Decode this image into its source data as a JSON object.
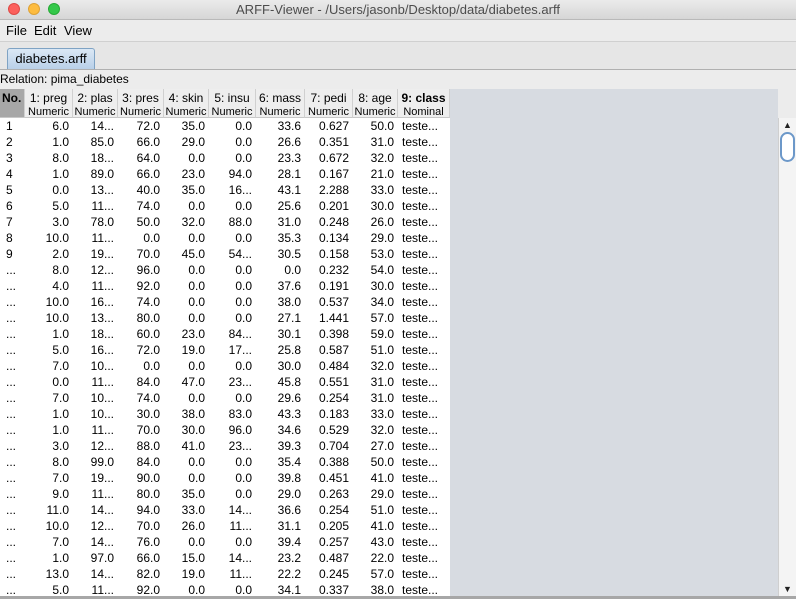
{
  "window": {
    "title": "ARFF-Viewer - /Users/jasonb/Desktop/data/diabetes.arff"
  },
  "menu": {
    "file": "File",
    "edit": "Edit",
    "view": "View"
  },
  "tab": {
    "label": "diabetes.arff"
  },
  "relation": "Relation: pima_diabetes",
  "columns": [
    {
      "name": "No.",
      "type": ""
    },
    {
      "name": "1: preg",
      "type": "Numeric"
    },
    {
      "name": "2: plas",
      "type": "Numeric"
    },
    {
      "name": "3: pres",
      "type": "Numeric"
    },
    {
      "name": "4: skin",
      "type": "Numeric"
    },
    {
      "name": "5: insu",
      "type": "Numeric"
    },
    {
      "name": "6: mass",
      "type": "Numeric"
    },
    {
      "name": "7: pedi",
      "type": "Numeric"
    },
    {
      "name": "8: age",
      "type": "Numeric"
    },
    {
      "name": "9: class",
      "type": "Nominal"
    }
  ],
  "rows": [
    [
      "1",
      "6.0",
      "14...",
      "72.0",
      "35.0",
      "0.0",
      "33.6",
      "0.627",
      "50.0",
      "teste..."
    ],
    [
      "2",
      "1.0",
      "85.0",
      "66.0",
      "29.0",
      "0.0",
      "26.6",
      "0.351",
      "31.0",
      "teste..."
    ],
    [
      "3",
      "8.0",
      "18...",
      "64.0",
      "0.0",
      "0.0",
      "23.3",
      "0.672",
      "32.0",
      "teste..."
    ],
    [
      "4",
      "1.0",
      "89.0",
      "66.0",
      "23.0",
      "94.0",
      "28.1",
      "0.167",
      "21.0",
      "teste..."
    ],
    [
      "5",
      "0.0",
      "13...",
      "40.0",
      "35.0",
      "16...",
      "43.1",
      "2.288",
      "33.0",
      "teste..."
    ],
    [
      "6",
      "5.0",
      "11...",
      "74.0",
      "0.0",
      "0.0",
      "25.6",
      "0.201",
      "30.0",
      "teste..."
    ],
    [
      "7",
      "3.0",
      "78.0",
      "50.0",
      "32.0",
      "88.0",
      "31.0",
      "0.248",
      "26.0",
      "teste..."
    ],
    [
      "8",
      "10.0",
      "11...",
      "0.0",
      "0.0",
      "0.0",
      "35.3",
      "0.134",
      "29.0",
      "teste..."
    ],
    [
      "9",
      "2.0",
      "19...",
      "70.0",
      "45.0",
      "54...",
      "30.5",
      "0.158",
      "53.0",
      "teste..."
    ],
    [
      "...",
      "8.0",
      "12...",
      "96.0",
      "0.0",
      "0.0",
      "0.0",
      "0.232",
      "54.0",
      "teste..."
    ],
    [
      "...",
      "4.0",
      "11...",
      "92.0",
      "0.0",
      "0.0",
      "37.6",
      "0.191",
      "30.0",
      "teste..."
    ],
    [
      "...",
      "10.0",
      "16...",
      "74.0",
      "0.0",
      "0.0",
      "38.0",
      "0.537",
      "34.0",
      "teste..."
    ],
    [
      "...",
      "10.0",
      "13...",
      "80.0",
      "0.0",
      "0.0",
      "27.1",
      "1.441",
      "57.0",
      "teste..."
    ],
    [
      "...",
      "1.0",
      "18...",
      "60.0",
      "23.0",
      "84...",
      "30.1",
      "0.398",
      "59.0",
      "teste..."
    ],
    [
      "...",
      "5.0",
      "16...",
      "72.0",
      "19.0",
      "17...",
      "25.8",
      "0.587",
      "51.0",
      "teste..."
    ],
    [
      "...",
      "7.0",
      "10...",
      "0.0",
      "0.0",
      "0.0",
      "30.0",
      "0.484",
      "32.0",
      "teste..."
    ],
    [
      "...",
      "0.0",
      "11...",
      "84.0",
      "47.0",
      "23...",
      "45.8",
      "0.551",
      "31.0",
      "teste..."
    ],
    [
      "...",
      "7.0",
      "10...",
      "74.0",
      "0.0",
      "0.0",
      "29.6",
      "0.254",
      "31.0",
      "teste..."
    ],
    [
      "...",
      "1.0",
      "10...",
      "30.0",
      "38.0",
      "83.0",
      "43.3",
      "0.183",
      "33.0",
      "teste..."
    ],
    [
      "...",
      "1.0",
      "11...",
      "70.0",
      "30.0",
      "96.0",
      "34.6",
      "0.529",
      "32.0",
      "teste..."
    ],
    [
      "...",
      "3.0",
      "12...",
      "88.0",
      "41.0",
      "23...",
      "39.3",
      "0.704",
      "27.0",
      "teste..."
    ],
    [
      "...",
      "8.0",
      "99.0",
      "84.0",
      "0.0",
      "0.0",
      "35.4",
      "0.388",
      "50.0",
      "teste..."
    ],
    [
      "...",
      "7.0",
      "19...",
      "90.0",
      "0.0",
      "0.0",
      "39.8",
      "0.451",
      "41.0",
      "teste..."
    ],
    [
      "...",
      "9.0",
      "11...",
      "80.0",
      "35.0",
      "0.0",
      "29.0",
      "0.263",
      "29.0",
      "teste..."
    ],
    [
      "...",
      "11.0",
      "14...",
      "94.0",
      "33.0",
      "14...",
      "36.6",
      "0.254",
      "51.0",
      "teste..."
    ],
    [
      "...",
      "10.0",
      "12...",
      "70.0",
      "26.0",
      "11...",
      "31.1",
      "0.205",
      "41.0",
      "teste..."
    ],
    [
      "...",
      "7.0",
      "14...",
      "76.0",
      "0.0",
      "0.0",
      "39.4",
      "0.257",
      "43.0",
      "teste..."
    ],
    [
      "...",
      "1.0",
      "97.0",
      "66.0",
      "15.0",
      "14...",
      "23.2",
      "0.487",
      "22.0",
      "teste..."
    ],
    [
      "...",
      "13.0",
      "14...",
      "82.0",
      "19.0",
      "11...",
      "22.2",
      "0.245",
      "57.0",
      "teste..."
    ],
    [
      "...",
      "5.0",
      "11...",
      "92.0",
      "0.0",
      "0.0",
      "34.1",
      "0.337",
      "38.0",
      "teste..."
    ]
  ]
}
